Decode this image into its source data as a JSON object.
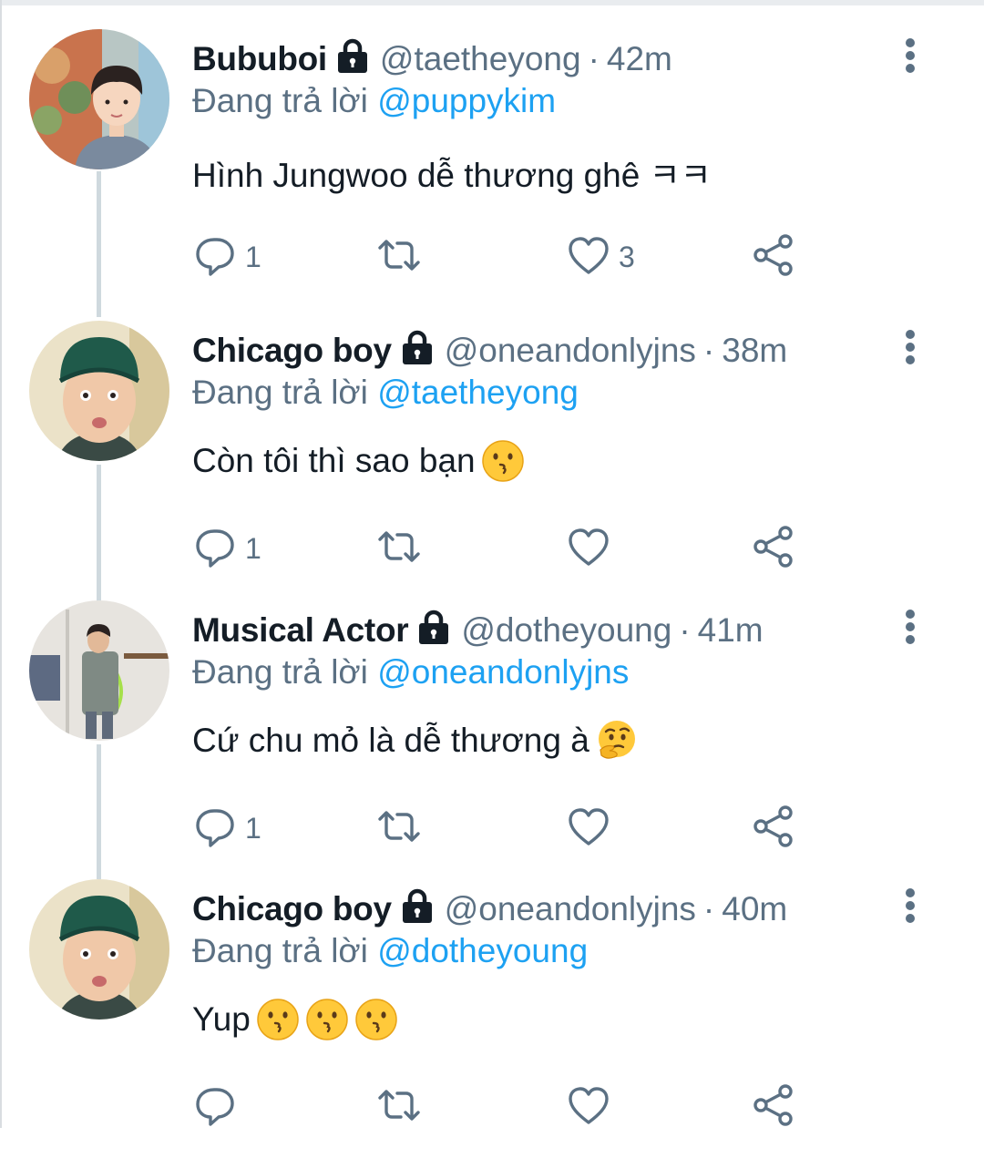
{
  "tweets": [
    {
      "display_name": "Bububoi",
      "handle": "@taetheyong",
      "separator": "·",
      "time": "42m",
      "replying_label": "Đang trả lời",
      "replying_to": "@puppykim",
      "text": "Hình Jungwoo dễ thương ghê ㅋㅋ",
      "emojis": [],
      "reply_count": "1",
      "retweet_count": "",
      "like_count": "3",
      "avatar": "avatar-photo-boy-painting"
    },
    {
      "display_name": "Chicago boy",
      "handle": "@oneandonlyjns",
      "separator": "·",
      "time": "38m",
      "replying_label": "Đang trả lời",
      "replying_to": "@taetheyong",
      "text": "Còn tôi thì sao bạn",
      "emojis": [
        "kissing-face"
      ],
      "reply_count": "1",
      "retweet_count": "",
      "like_count": "",
      "avatar": "avatar-photo-boy-beanie"
    },
    {
      "display_name": "Musical Actor",
      "handle": "@dotheyoung",
      "separator": "·",
      "time": "41m",
      "replying_label": "Đang trả lời",
      "replying_to": "@oneandonlyjns",
      "text": "Cứ chu mỏ là dễ thương à",
      "emojis": [
        "thinking-face"
      ],
      "reply_count": "1",
      "retweet_count": "",
      "like_count": "",
      "avatar": "avatar-photo-mirror"
    },
    {
      "display_name": "Chicago boy",
      "handle": "@oneandonlyjns",
      "separator": "·",
      "time": "40m",
      "replying_label": "Đang trả lời",
      "replying_to": "@dotheyoung",
      "text": "Yup",
      "emojis": [
        "kissing-face",
        "kissing-face",
        "kissing-face"
      ],
      "reply_count": "",
      "retweet_count": "",
      "like_count": "",
      "avatar": "avatar-photo-boy-beanie"
    }
  ],
  "icons": {
    "reply": "reply-icon",
    "retweet": "retweet-icon",
    "like": "like-icon",
    "share": "share-icon",
    "lock": "lock-icon",
    "more": "more-options-icon"
  },
  "colors": {
    "name": "#141d26",
    "secondary": "#5b7083",
    "link": "#1da1f2",
    "thread_line": "#cfd9de"
  }
}
